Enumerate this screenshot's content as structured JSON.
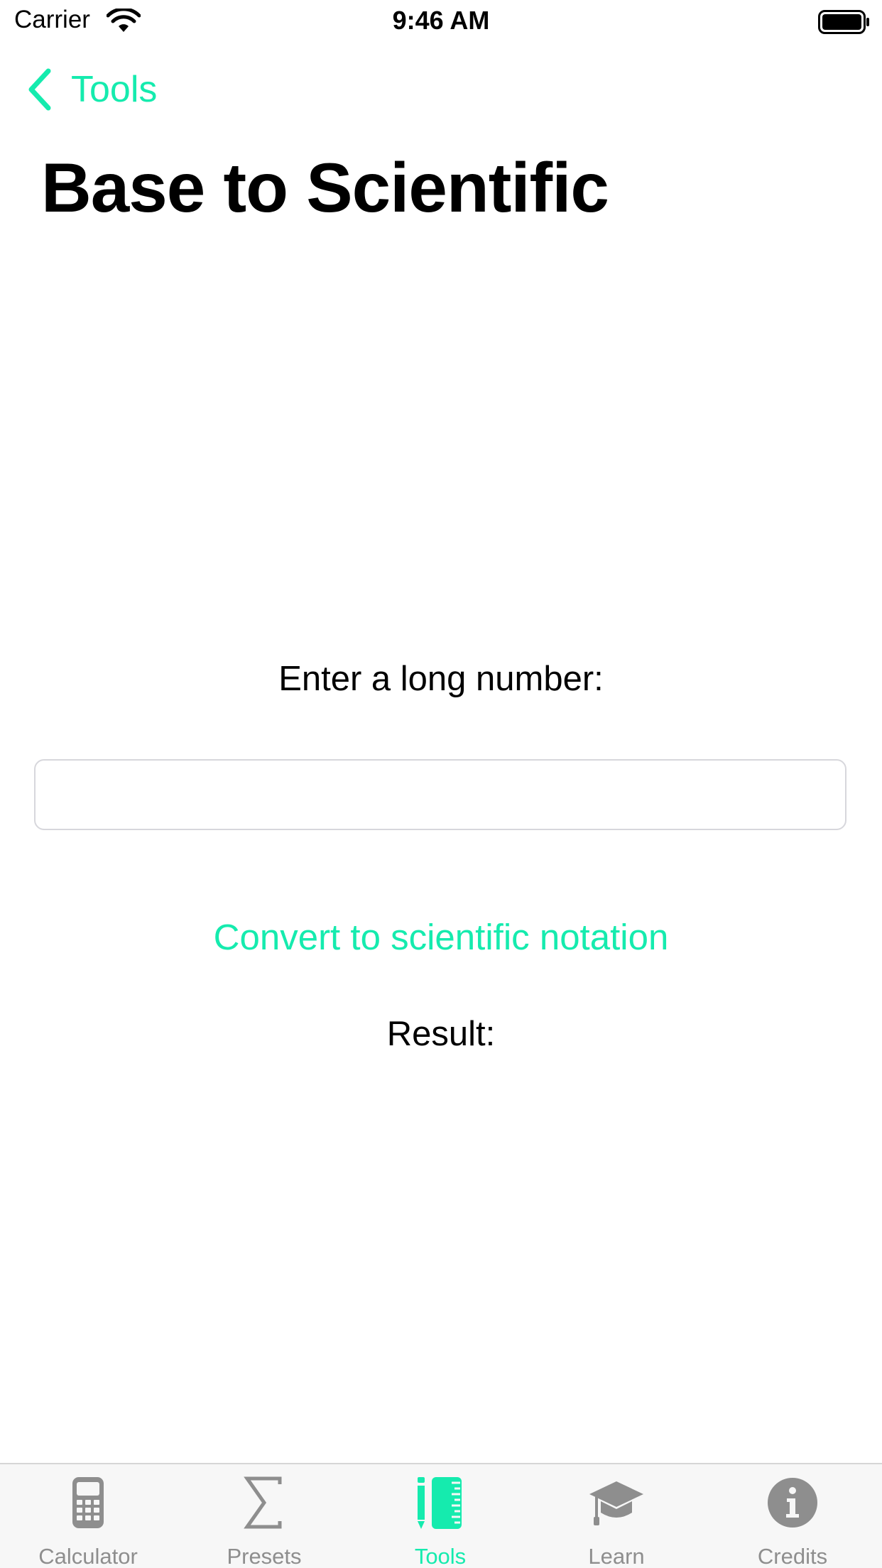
{
  "status_bar": {
    "carrier": "Carrier",
    "time": "9:46 AM"
  },
  "nav": {
    "back_label": "Tools"
  },
  "page": {
    "title": "Base to Scientific",
    "prompt": "Enter a long number:",
    "input_value": "",
    "input_placeholder": "",
    "convert_label": "Convert to scientific notation",
    "result_label": "Result:"
  },
  "tab_bar": {
    "tabs": [
      {
        "label": "Calculator",
        "icon": "calculator-icon",
        "active": false
      },
      {
        "label": "Presets",
        "icon": "sigma-icon",
        "active": false
      },
      {
        "label": "Tools",
        "icon": "pencil-ruler-icon",
        "active": true
      },
      {
        "label": "Learn",
        "icon": "graduation-cap-icon",
        "active": false
      },
      {
        "label": "Credits",
        "icon": "info-icon",
        "active": false
      }
    ]
  },
  "colors": {
    "accent": "#15ebae",
    "inactive": "#8e8e8e"
  }
}
